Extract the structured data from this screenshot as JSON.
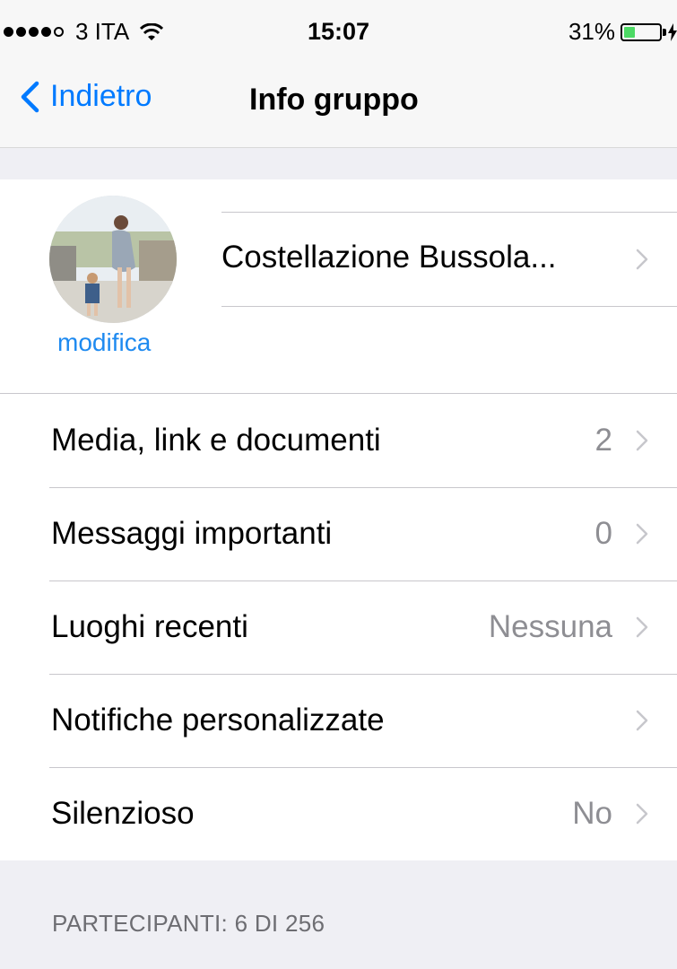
{
  "status_bar": {
    "carrier": "3 ITA",
    "time": "15:07",
    "battery_percent": "31%",
    "battery_level": 0.31,
    "signal_bars": 4,
    "icons": [
      "wifi-icon",
      "battery-icon",
      "charging-bolt-icon"
    ],
    "battery_color": "#4cd964"
  },
  "nav": {
    "back_label": "Indietro",
    "title": "Info gruppo",
    "accent_color": "#007aff"
  },
  "group": {
    "name": "Costellazione Bussola...",
    "edit_label": "modifica"
  },
  "rows": [
    {
      "label": "Media, link e documenti",
      "value": "2"
    },
    {
      "label": "Messaggi importanti",
      "value": "0"
    },
    {
      "label": "Luoghi recenti",
      "value": "Nessuna"
    },
    {
      "label": "Notifiche personalizzate",
      "value": ""
    },
    {
      "label": "Silenzioso",
      "value": "No"
    }
  ],
  "participants": {
    "caption": "PARTECIPANTI: 6 DI 256"
  }
}
